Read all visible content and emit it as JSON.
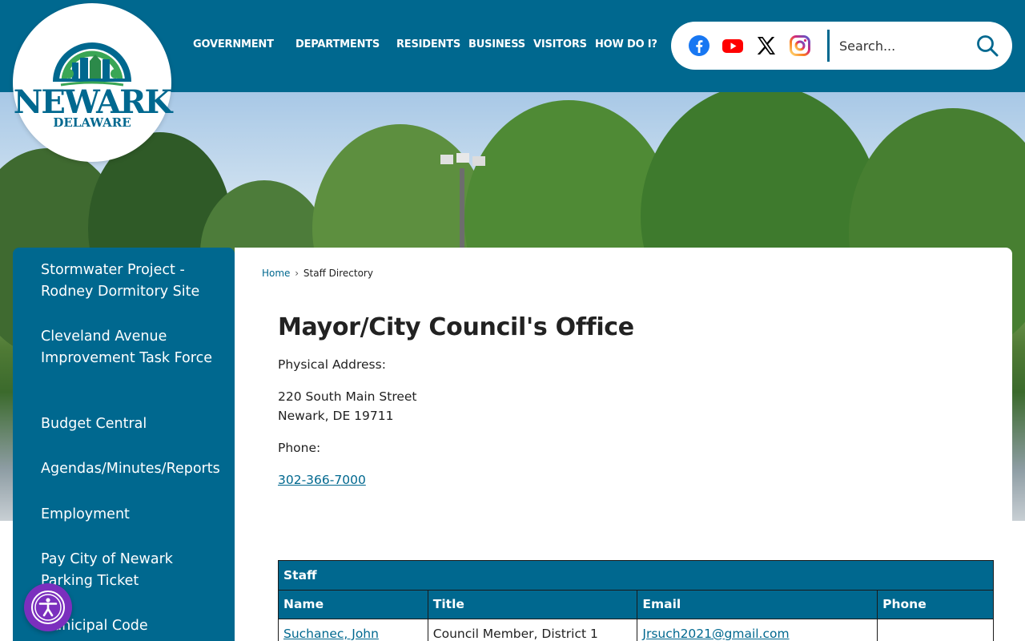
{
  "logo": {
    "name": "NEWARK",
    "state": "DELAWARE"
  },
  "nav": {
    "items": [
      "GOVERNMENT",
      "DEPARTMENTS",
      "RESIDENTS",
      "BUSINESS",
      "VISITORS",
      "HOW DO I?"
    ]
  },
  "social": {
    "icons": [
      "facebook-icon",
      "youtube-icon",
      "x-twitter-icon",
      "instagram-icon"
    ]
  },
  "search": {
    "placeholder": "Search..."
  },
  "sidebar": {
    "items": [
      {
        "label": "Stormwater Project - Rodney Dormitory Site"
      },
      {
        "label": "Cleveland Avenue Improvement Task Force"
      },
      {
        "label": "Budget Central"
      },
      {
        "label": "Agendas/Minutes/Reports"
      },
      {
        "label": "Employment"
      },
      {
        "label": "Pay City of Newark Parking Ticket"
      },
      {
        "label": "Municipal Code"
      }
    ]
  },
  "breadcrumb": {
    "home": "Home",
    "separator": "›",
    "current": "Staff Directory"
  },
  "page": {
    "title": "Mayor/City Council's Office",
    "address_label": "Physical Address:",
    "address_line1": "220 South Main Street",
    "address_line2": "Newark, DE 19711",
    "phone_label": "Phone:",
    "phone": "302-366-7000"
  },
  "staff_table": {
    "caption": "Staff",
    "headers": {
      "name": "Name",
      "title": "Title",
      "email": "Email",
      "phone": "Phone"
    },
    "rows": [
      {
        "name": "Suchanec, John",
        "title": "Council Member, District 1",
        "email": "Jrsuch2021@gmail.com",
        "phone": ""
      }
    ]
  },
  "colors": {
    "brand": "#00688f",
    "accessibility": "#7b2fbe"
  }
}
